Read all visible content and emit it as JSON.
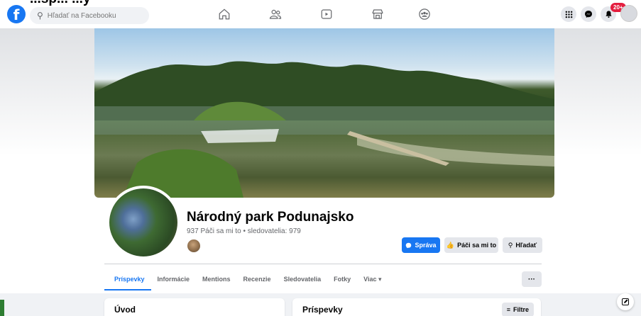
{
  "topbar": {
    "search_placeholder": "Hľadať na Facebooku",
    "notifications_badge": "20+",
    "nav_icons": [
      "home-icon",
      "friends-icon",
      "watch-icon",
      "marketplace-icon",
      "groups-icon"
    ],
    "right_icons": [
      "menu-grid-icon",
      "messenger-icon",
      "bell-icon"
    ]
  },
  "overlay_heading": "...sp... ...y",
  "page": {
    "name": "Národný park Podunajsko",
    "stats": "937 Páči sa mi to • sledovatelia: 979"
  },
  "buttons": {
    "message": "Správa",
    "like": "Páči sa mi to",
    "search": "Hľadať",
    "more": "···"
  },
  "tabs": [
    {
      "label": "Príspevky",
      "active": true
    },
    {
      "label": "Informácie",
      "active": false
    },
    {
      "label": "Mentions",
      "active": false
    },
    {
      "label": "Recenzie",
      "active": false
    },
    {
      "label": "Sledovatelia",
      "active": false
    },
    {
      "label": "Fotky",
      "active": false
    },
    {
      "label": "Viac ▾",
      "active": false
    }
  ],
  "cards": {
    "intro_title": "Úvod",
    "posts_title": "Príspevky",
    "filter_label": "Filtre"
  },
  "colors": {
    "brand": "#1877f2",
    "badge": "#e41e3f",
    "background": "#f0f2f5"
  }
}
